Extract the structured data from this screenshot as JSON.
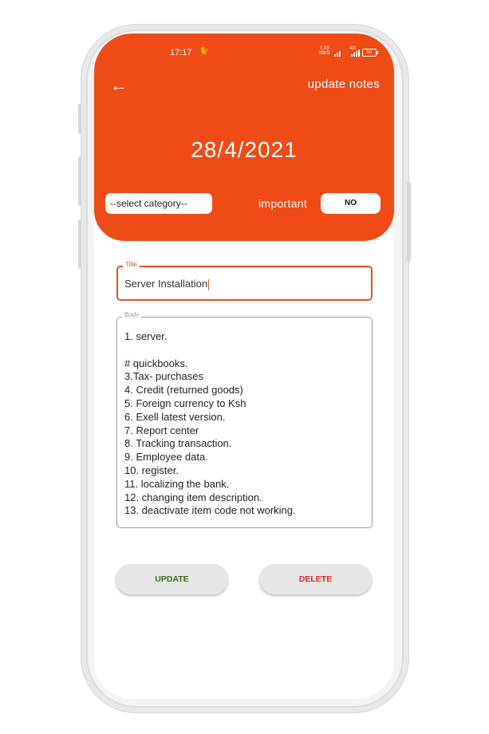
{
  "status_bar": {
    "time": "17:17",
    "notification_glyph": "🐈",
    "net_speed_value": "1.00",
    "net_speed_unit": "KB/S",
    "signal_label": "4G",
    "battery": "60"
  },
  "header": {
    "back_icon": "←",
    "title": "update notes",
    "date": "28/4/2021",
    "category_select": "--select category--",
    "important_label": "important",
    "important_value": "NO"
  },
  "form": {
    "title_label": "Title",
    "title_value": "Server Installation",
    "body_label": "Body",
    "body_value": "1. server.\n\n# quickbooks.\n3.Tax- purchases\n4. Credit (returned goods)\n5. Foreign currency to Ksh\n6. Exell latest version.\n7. Report center\n8. Tracking transaction.\n9. Employee data.\n10. register.\n11. localizing the bank.\n12. changing item description.\n13. deactivate item code not working."
  },
  "actions": {
    "update_label": "UPDATE",
    "delete_label": "DELETE"
  },
  "colors": {
    "accent": "#ef4b16",
    "update_text": "#2d6a2a",
    "delete_text": "#e0262c"
  }
}
